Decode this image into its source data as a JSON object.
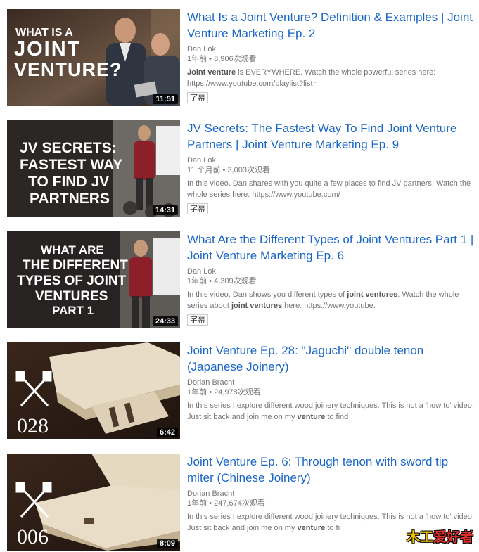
{
  "results": [
    {
      "thumb_lines": [
        "WHAT IS A",
        "JOINT",
        "VENTURE?"
      ],
      "duration": "11:51",
      "title": "What Is a Joint Venture? Definition & Examples | Joint Venture Marketing Ep. 2",
      "channel": "Dan Lok",
      "meta": "1年前 • 8,906次观看",
      "desc_parts": [
        {
          "t": "Joint venture",
          "b": true
        },
        {
          "t": " is EVERYWHERE. Watch the whole powerful series here: https://www.youtube.com/playlist?list=",
          "b": false
        }
      ],
      "badge": "字幕"
    },
    {
      "thumb_lines": [
        "JV SECRETS:",
        "FASTEST WAY",
        "TO FIND JV",
        "PARTNERS"
      ],
      "duration": "14:31",
      "title": "JV Secrets: The Fastest Way To Find Joint Venture Partners | Joint Venture Marketing Ep. 9",
      "channel": "Dan Lok",
      "meta": "11 个月前 • 3,003次观看",
      "desc_parts": [
        {
          "t": "In this video, Dan shares with you quite a few places to find JV partners. Watch the whole series here: https://www.youtube.com/",
          "b": false
        }
      ],
      "badge": "字幕"
    },
    {
      "thumb_lines": [
        "WHAT ARE",
        "THE DIFFERENT",
        "TYPES OF JOINT",
        "VENTURES",
        "PART 1"
      ],
      "duration": "24:33",
      "title": "What Are the Different Types of Joint Ventures Part 1 | Joint Venture Marketing Ep. 6",
      "channel": "Dan Lok",
      "meta": "1年前 • 4,309次观看",
      "desc_parts": [
        {
          "t": "In this video, Dan shows you different types of ",
          "b": false
        },
        {
          "t": "joint ventures",
          "b": true
        },
        {
          "t": ". Watch the whole series about ",
          "b": false
        },
        {
          "t": "joint ventures",
          "b": true
        },
        {
          "t": " here: https://www.youtube.",
          "b": false
        }
      ],
      "badge": "字幕"
    },
    {
      "thumb_lines": [
        "028"
      ],
      "duration": "6:42",
      "title": "Joint Venture Ep. 28: \"Jaguchi\" double tenon (Japanese Joinery)",
      "channel": "Dorian Bracht",
      "meta": "1年前 • 24,978次观看",
      "desc_parts": [
        {
          "t": "In this series I explore different wood joinery techniques. This is not a 'how to' video. Just sit back and join me on my ",
          "b": false
        },
        {
          "t": "venture",
          "b": true
        },
        {
          "t": " to find",
          "b": false
        }
      ],
      "badge": ""
    },
    {
      "thumb_lines": [
        "006"
      ],
      "duration": "8:09",
      "title": "Joint Venture Ep. 6: Through tenon with sword tip miter (Chinese Joinery)",
      "channel": "Dorian Bracht",
      "meta": "1年前 • 247,674次观看",
      "desc_parts": [
        {
          "t": "In this series I explore different wood joinery techniques. This is not a 'how to' video. Just sit back and join me on my ",
          "b": false
        },
        {
          "t": "venture",
          "b": true
        },
        {
          "t": " to fi",
          "b": false
        }
      ],
      "badge": ""
    }
  ],
  "watermark": {
    "part1": "木工",
    "part2": "爱好者"
  }
}
